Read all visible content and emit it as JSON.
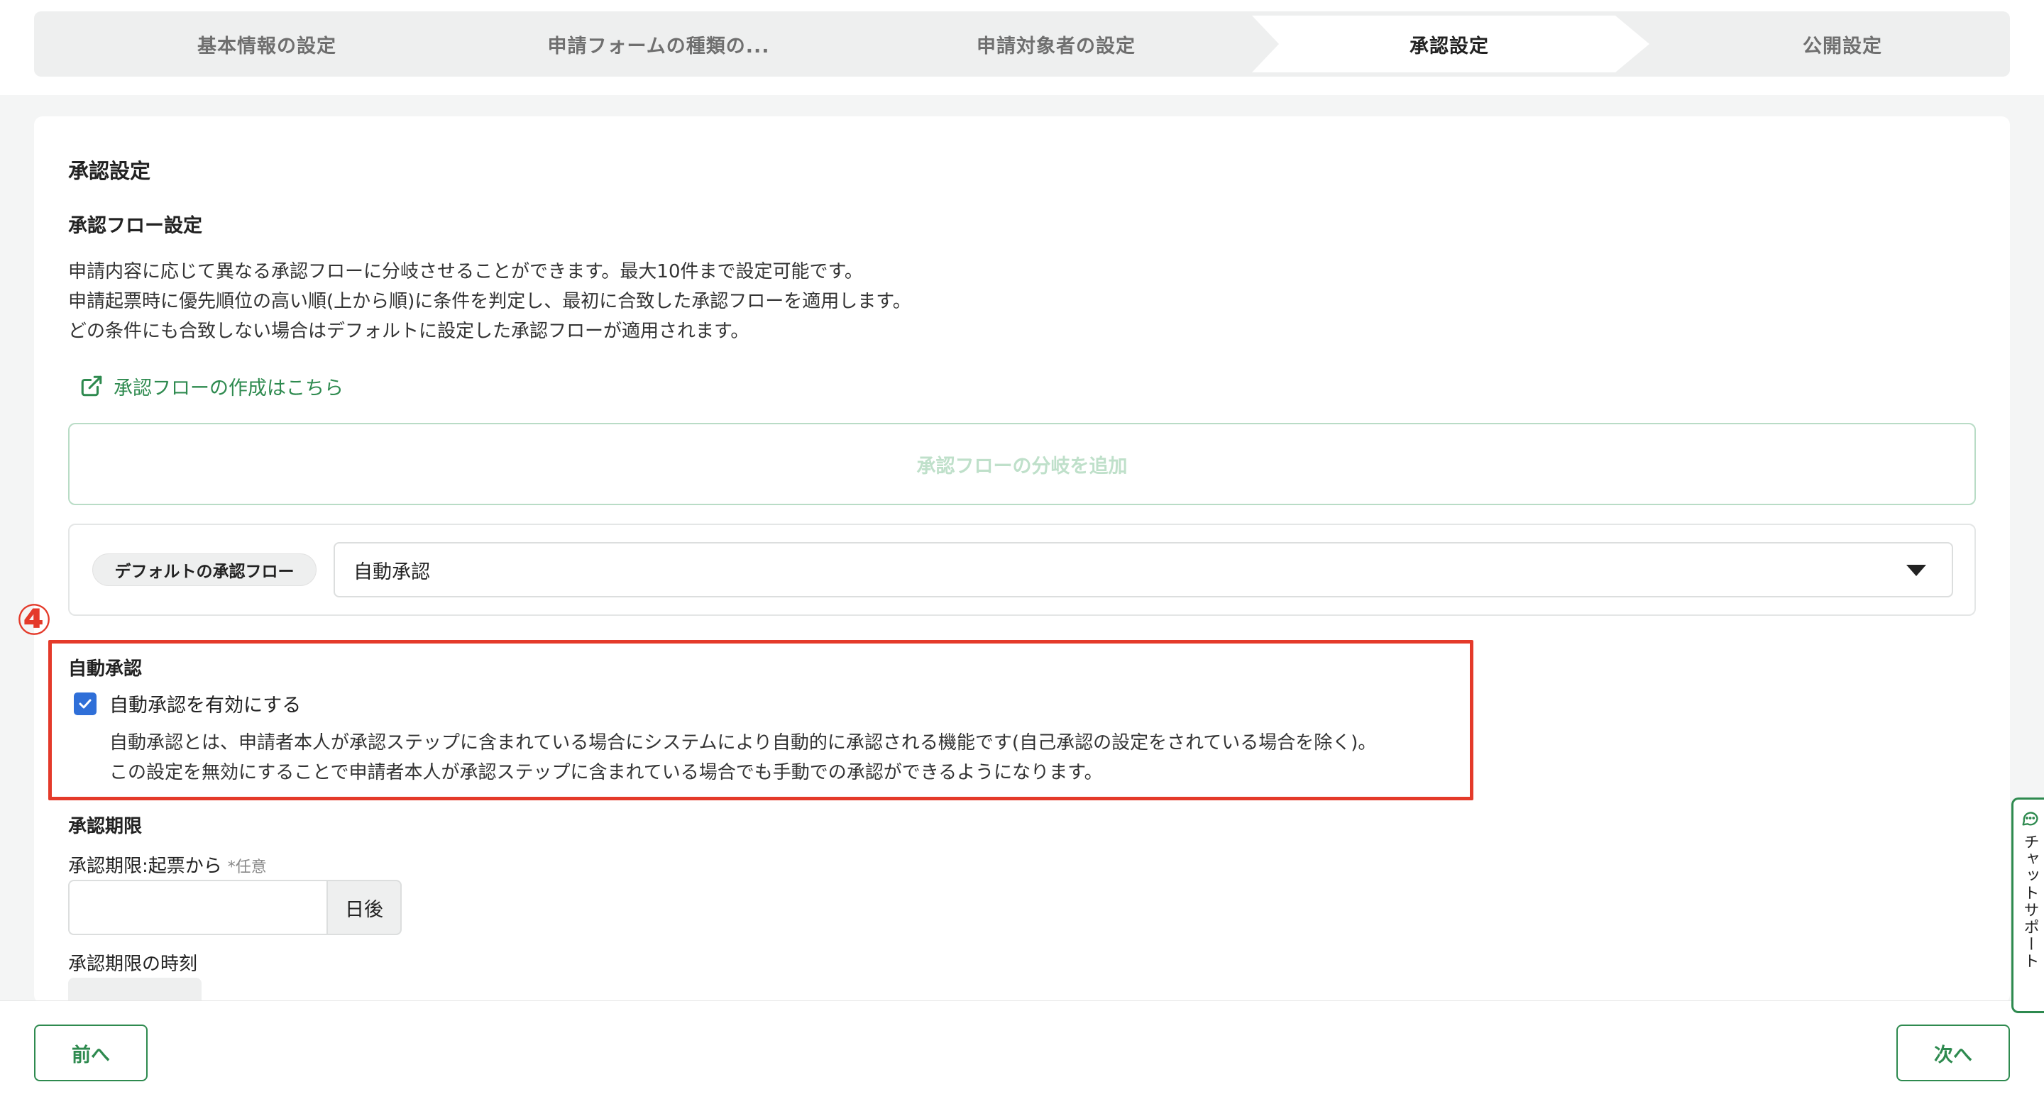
{
  "stepper": {
    "steps": [
      {
        "label": "基本情報の設定"
      },
      {
        "label": "申請フォームの種類の..."
      },
      {
        "label": "申請対象者の設定"
      },
      {
        "label": "承認設定"
      },
      {
        "label": "公開設定"
      }
    ],
    "active_index": 3
  },
  "page": {
    "title": "承認設定",
    "flow_section": {
      "title": "承認フロー設定",
      "description": [
        "申請内容に応じて異なる承認フローに分岐させることができます。最大10件まで設定可能です。",
        "申請起票時に優先順位の高い順(上から順)に条件を判定し、最初に合致した承認フローを適用します。",
        "どの条件にも合致しない場合はデフォルトに設定した承認フローが適用されます。"
      ],
      "create_link": "承認フローの作成はこちら",
      "add_branch_label": "承認フローの分岐を追加",
      "default_flow": {
        "chip_label": "デフォルトの承認フロー",
        "selected": "自動承認"
      }
    },
    "callout_number": "④",
    "auto_approval": {
      "title": "自動承認",
      "checkbox_label": "自動承認を有効にする",
      "checked": true,
      "description": [
        "自動承認とは、申請者本人が承認ステップに含まれている場合にシステムにより自動的に承認される機能です(自己承認の設定をされている場合を除く)。",
        "この設定を無効にすることで申請者本人が承認ステップに含まれている場合でも手動での承認ができるようになります。"
      ]
    },
    "deadline": {
      "title": "承認期限",
      "field_label": "承認期限:起票から",
      "optional_mark": "*任意",
      "input_value": "",
      "suffix": "日後",
      "time_label": "承認期限の時刻"
    }
  },
  "footer": {
    "prev_label": "前へ",
    "next_label": "次へ"
  },
  "chat_support": {
    "label": "チャットサポート"
  },
  "colors": {
    "accent_green": "#2e8a4f",
    "callout_red": "#e43a2a",
    "checkbox_blue": "#2f6fd8"
  }
}
